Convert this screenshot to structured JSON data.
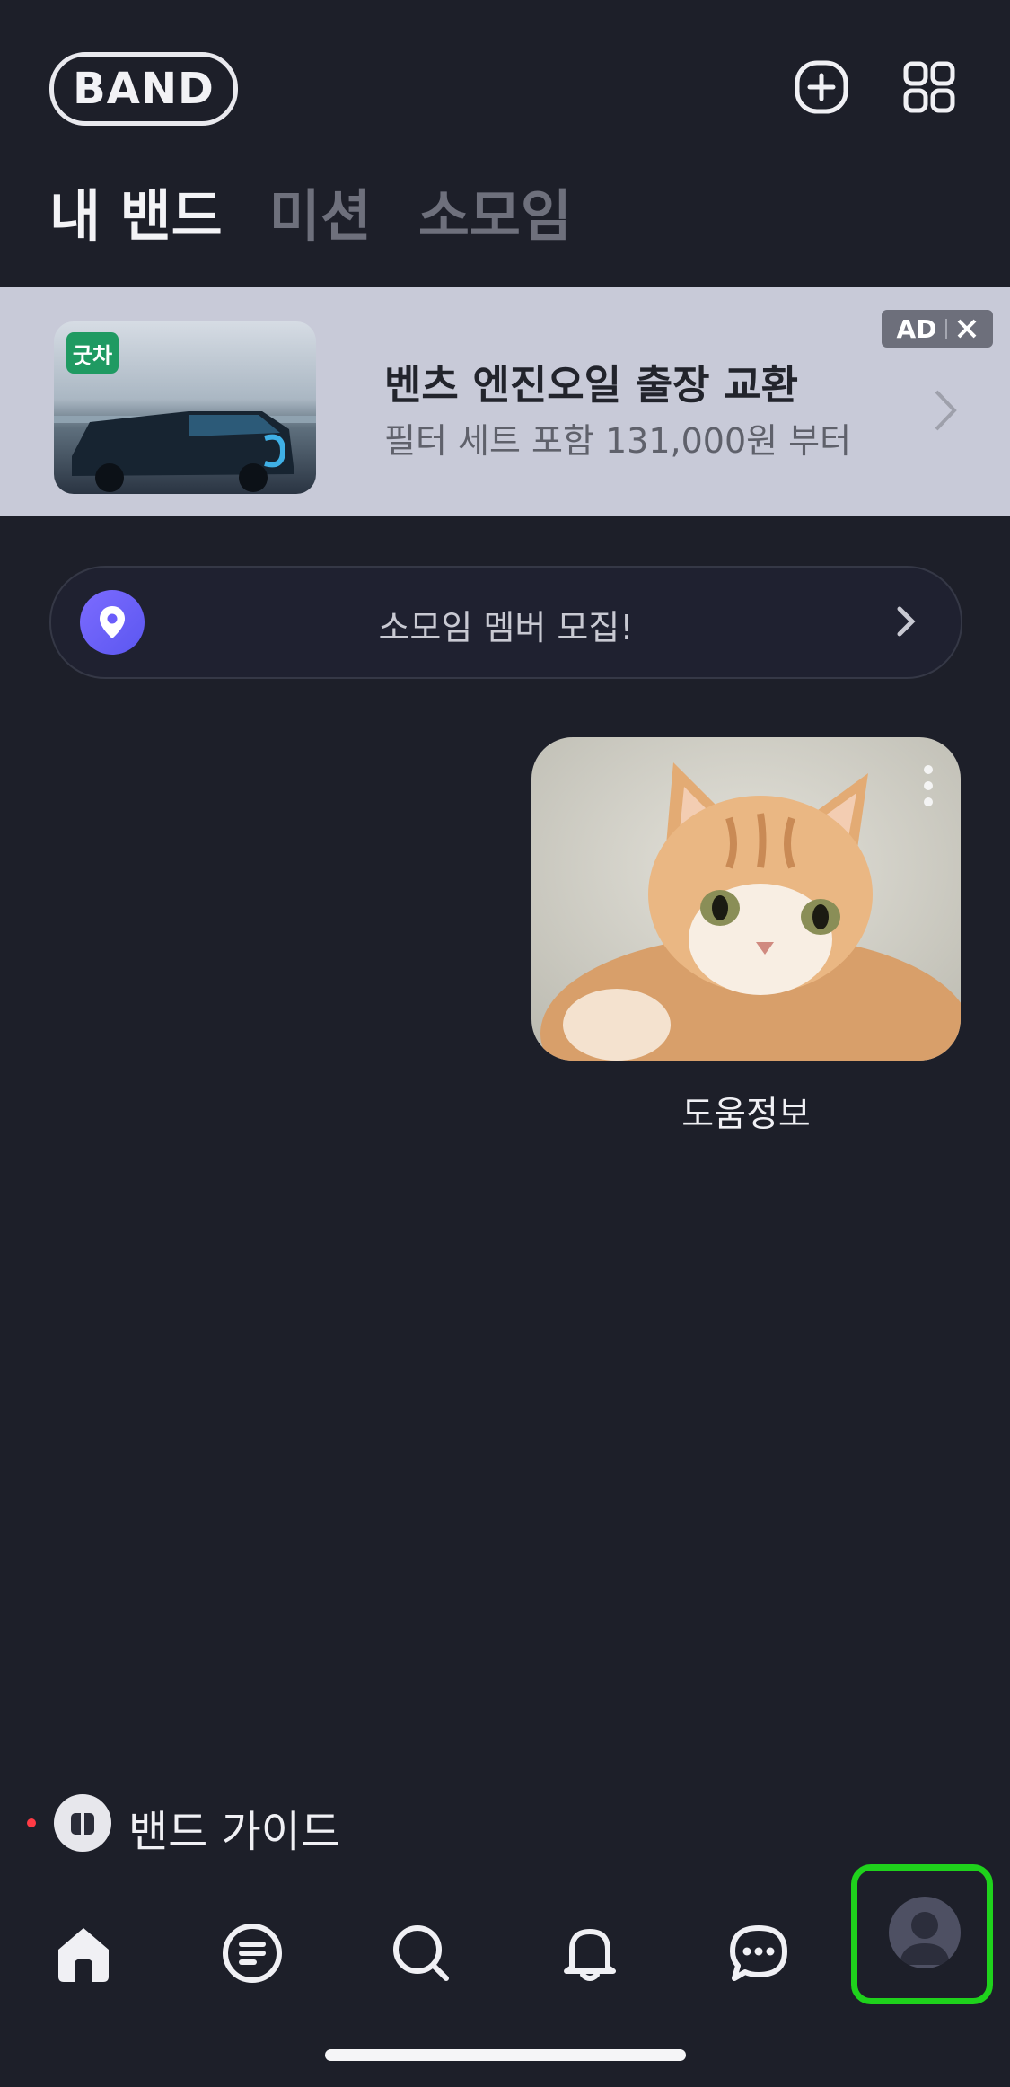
{
  "header": {
    "logo": "BAND",
    "tabs": [
      {
        "label": "내 밴드",
        "active": true
      },
      {
        "label": "미션",
        "active": false
      },
      {
        "label": "소모임",
        "active": false
      }
    ],
    "icons": [
      "plus-circle-icon",
      "grid-icon"
    ]
  },
  "ad": {
    "thumb_tag": "굿차",
    "title": "벤츠 엔진오일 출장 교환",
    "subtitle": "필터 세트 포함 131,000원 부터",
    "badge": "AD"
  },
  "recruit": {
    "text": "소모임 멤버 모집!"
  },
  "bands": [
    {
      "name": "도움정보"
    }
  ],
  "guide": {
    "label": "밴드 가이드"
  },
  "nav": [
    "home-icon",
    "feed-icon",
    "search-icon",
    "bell-icon",
    "chat-icon",
    "profile-icon"
  ],
  "colors": {
    "background": "#1d1f29",
    "ad_background": "#c8cad8",
    "accent_purple": "#6b5cff",
    "highlight_green": "#1fd21c"
  }
}
